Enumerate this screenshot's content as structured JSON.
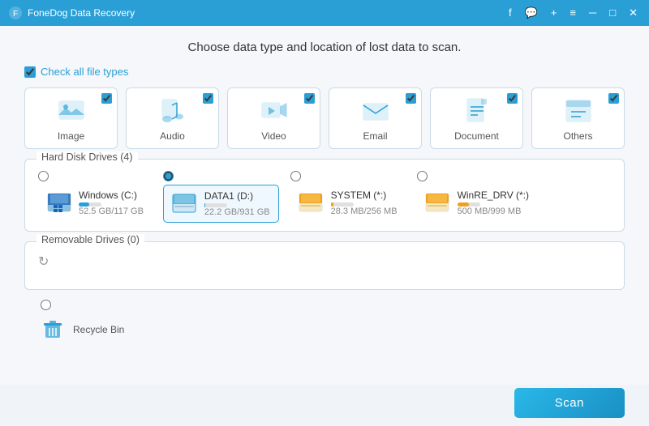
{
  "titlebar": {
    "title": "FoneDog Data Recovery",
    "fb_icon": "f",
    "chat_icon": "💬",
    "plus_icon": "+",
    "menu_icon": "≡",
    "min_icon": "─",
    "max_icon": "□",
    "close_icon": "✕"
  },
  "main": {
    "heading": "Choose data type and location of lost data to scan.",
    "check_all_label": "Check all file types",
    "file_types": [
      {
        "id": "image",
        "label": "Image",
        "checked": true
      },
      {
        "id": "audio",
        "label": "Audio",
        "checked": true
      },
      {
        "id": "video",
        "label": "Video",
        "checked": true
      },
      {
        "id": "email",
        "label": "Email",
        "checked": true
      },
      {
        "id": "document",
        "label": "Document",
        "checked": true
      },
      {
        "id": "others",
        "label": "Others",
        "checked": true
      }
    ],
    "hard_disk_section": {
      "title": "Hard Disk Drives (4)",
      "drives": [
        {
          "id": "c",
          "name": "Windows (C:)",
          "size": "52.5 GB/117 GB",
          "selected": false,
          "bar_pct": 45,
          "bar_color": "blue",
          "icon": "windows"
        },
        {
          "id": "d",
          "name": "DATA1 (D:)",
          "size": "22.2 GB/931 GB",
          "selected": true,
          "bar_pct": 2,
          "bar_color": "blue",
          "icon": "hdd"
        },
        {
          "id": "system",
          "name": "SYSTEM (*:)",
          "size": "28.3 MB/256 MB",
          "selected": false,
          "bar_pct": 11,
          "bar_color": "orange",
          "icon": "hdd_plain"
        },
        {
          "id": "winre",
          "name": "WinRE_DRV (*:)",
          "size": "500 MB/999 MB",
          "selected": false,
          "bar_pct": 50,
          "bar_color": "orange",
          "icon": "hdd_plain"
        }
      ]
    },
    "removable_section": {
      "title": "Removable Drives (0)"
    },
    "recycle_bin": {
      "label": "Recycle Bin"
    },
    "scan_button": "Scan"
  },
  "colors": {
    "accent": "#2a9fd6",
    "orange": "#f0a020"
  }
}
